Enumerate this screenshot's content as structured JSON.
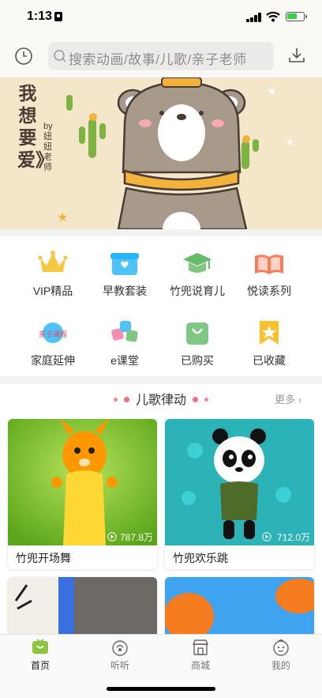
{
  "status": {
    "time": "1:13"
  },
  "search": {
    "placeholder": "搜索动画/故事/儿歌/亲子老师"
  },
  "banner": {
    "title": "我想要爱》",
    "subtitle": "by妞妞老师"
  },
  "categories": [
    {
      "label": "VIP精品",
      "icon": "crown-icon"
    },
    {
      "label": "早教套装",
      "icon": "gift-box-icon"
    },
    {
      "label": "竹兜说育儿",
      "icon": "graduation-cap-icon"
    },
    {
      "label": "悦读系列",
      "icon": "open-book-icon"
    },
    {
      "label": "家庭延伸",
      "icon": "family-course-icon",
      "icon_text": "亲子课程"
    },
    {
      "label": "e课堂",
      "icon": "e-classroom-icon"
    },
    {
      "label": "已购买",
      "icon": "shopping-bag-icon"
    },
    {
      "label": "已收藏",
      "icon": "bookmark-star-icon"
    }
  ],
  "section": {
    "title": "儿歌律动",
    "more": "更多",
    "cards": [
      {
        "title": "竹兜开场舞",
        "plays": "787.8万"
      },
      {
        "title": "竹兜欢乐跳",
        "plays": "712.0万"
      }
    ]
  },
  "tabs": [
    {
      "label": "首页",
      "icon": "tv-home-icon",
      "active": true
    },
    {
      "label": "听听",
      "icon": "listen-icon",
      "active": false
    },
    {
      "label": "商城",
      "icon": "store-icon",
      "active": false
    },
    {
      "label": "我的",
      "icon": "profile-face-icon",
      "active": false
    }
  ],
  "colors": {
    "accent": "#8cc63f",
    "pink": "#f5869a",
    "banner_bg": "#f4e6c8"
  }
}
